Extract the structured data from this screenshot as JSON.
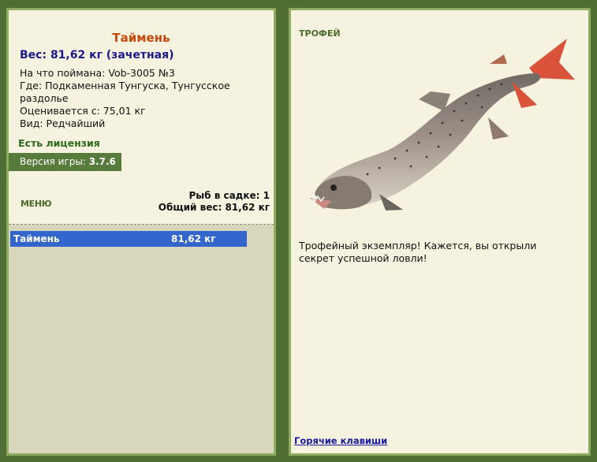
{
  "left": {
    "fish_name": "Таймень",
    "weight_line": "Вес: 81,62 кг (зачетная)",
    "caught_on": "На что поймана: Vob-3005 №3",
    "location": "Где: Подкаменная Тунгуска, Тунгусское раздолье",
    "valued_from": "Оценивается с: 75,01 кг",
    "species_type": "Вид: Редчайший",
    "license": "Есть лицензия",
    "version_label": "Версия игры: ",
    "version_value": "3.7.6",
    "menu_label": "МЕНЮ",
    "cage_count": "Рыб в садке: 1",
    "total_weight": "Общий вес: 81,62 кг",
    "catch_list": [
      {
        "name": "Таймень",
        "weight": "81,62 кг"
      }
    ]
  },
  "right": {
    "heading": "ТРОФЕЙ",
    "description": "Трофейный экземпляр! Кажется, вы открыли секрет успешной ловли!",
    "hotkeys_link": "Горячие клавиши"
  },
  "colors": {
    "background": "#4e6e34",
    "panel": "#f5f2df",
    "fish_name": "#c8480c",
    "weight": "#1a1a8c",
    "license": "#2d6a1c",
    "selected_row": "#3366cc"
  }
}
